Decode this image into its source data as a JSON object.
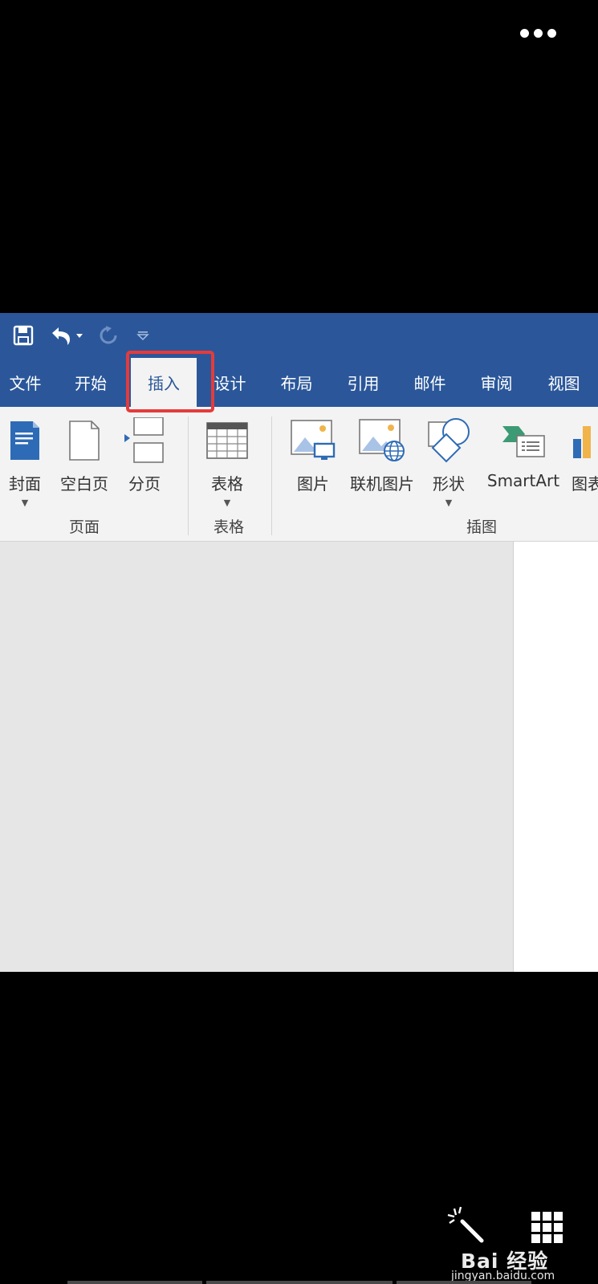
{
  "qat": {
    "save_icon": "save-icon",
    "undo_icon": "undo-icon",
    "redo_icon": "redo-icon",
    "customize_icon": "customize-qat-icon"
  },
  "tabs": [
    {
      "label": "文件",
      "active": false
    },
    {
      "label": "开始",
      "active": false
    },
    {
      "label": "插入",
      "active": true
    },
    {
      "label": "设计",
      "active": false
    },
    {
      "label": "布局",
      "active": false
    },
    {
      "label": "引用",
      "active": false
    },
    {
      "label": "邮件",
      "active": false
    },
    {
      "label": "审阅",
      "active": false
    },
    {
      "label": "视图",
      "active": false
    }
  ],
  "ribbon": {
    "pages_group": {
      "label": "页面",
      "cover": "封面",
      "blank_page": "空白页",
      "page_break": "分页"
    },
    "tables_group": {
      "label": "表格",
      "table": "表格"
    },
    "illustrations_group": {
      "label": "插图",
      "pictures": "图片",
      "online_pictures": "联机图片",
      "shapes": "形状",
      "smartart": "SmartArt",
      "chart": "图表"
    }
  },
  "watermark": {
    "brand": "Bai 经验",
    "url": "jingyan.baidu.com"
  },
  "colors": {
    "ribbon_blue": "#2b579a",
    "highlight_red": "#e53b3b",
    "ribbon_bg": "#f3f3f3",
    "canvas_bg": "#e6e6e6"
  }
}
